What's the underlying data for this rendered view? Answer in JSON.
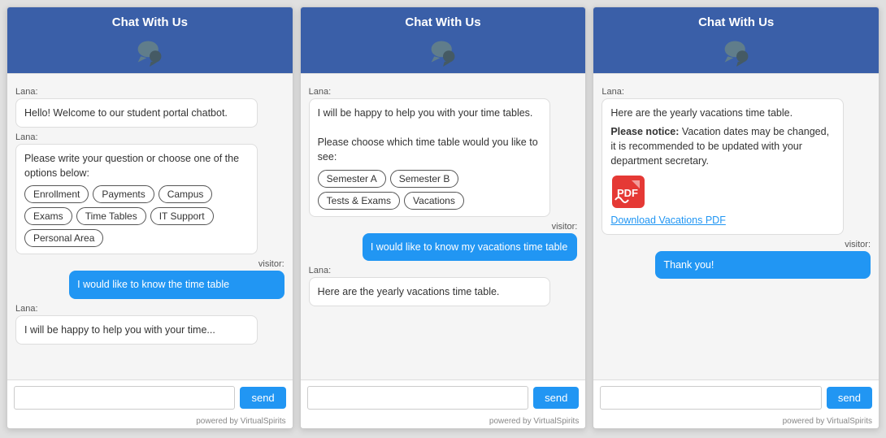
{
  "app": {
    "title": "Chat With Us",
    "powered_by": "powered by VirtualSpirits"
  },
  "panel1": {
    "header": "Chat With Us",
    "messages": [
      {
        "sender": "Lana",
        "type": "bot",
        "text": "Hello! Welcome to our student portal chatbot."
      },
      {
        "sender": "Lana",
        "type": "bot-options",
        "text": "Please write your question or choose one of the options below:",
        "options": [
          "Enrollment",
          "Payments",
          "Campus",
          "Exams",
          "Time Tables",
          "IT Support",
          "Personal Area"
        ]
      },
      {
        "sender": "visitor",
        "type": "visitor",
        "text": "I would like to know the time table"
      },
      {
        "sender": "Lana",
        "type": "bot-partial",
        "text": "I will be happy to help you with your time..."
      }
    ],
    "input_placeholder": "",
    "send_label": "send",
    "powered_by": "powered by VirtualSpirits"
  },
  "panel2": {
    "header": "Chat With Us",
    "messages": [
      {
        "sender": "Lana",
        "type": "bot",
        "text": "I will be happy to help you with your time tables.\n\nPlease choose which time table would you like to see:",
        "options": [
          "Semester A",
          "Semester B",
          "Tests & Exams",
          "Vacations"
        ]
      },
      {
        "sender": "visitor",
        "type": "visitor",
        "text": "I would like to know my vacations time table"
      },
      {
        "sender": "Lana",
        "type": "bot-partial",
        "text": "Here are the yearly vacations time table."
      }
    ],
    "input_placeholder": "",
    "send_label": "send",
    "powered_by": "powered by VirtualSpirits"
  },
  "panel3": {
    "header": "Chat With Us",
    "messages": [
      {
        "sender": "Lana",
        "type": "bot-pdf",
        "text_before": "Here are the yearly vacations time table.",
        "bold_label": "Please notice:",
        "text_notice": " Vacation dates may be changed, it is recommended to be updated with your department secretary.",
        "pdf_link": "Download Vacations PDF"
      },
      {
        "sender": "visitor",
        "type": "visitor",
        "text": "Thank you!"
      }
    ],
    "input_placeholder": "",
    "send_label": "send",
    "powered_by": "powered by VirtualSpirits"
  },
  "icons": {
    "chat_bubble": "💬",
    "pdf_color": "#e53935"
  }
}
